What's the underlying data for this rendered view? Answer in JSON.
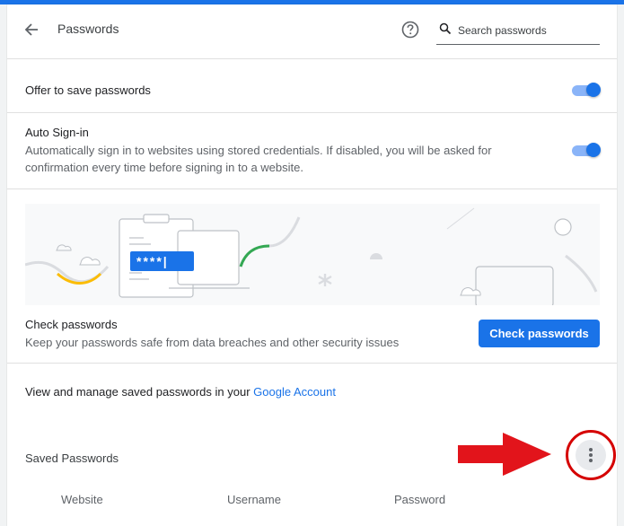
{
  "header": {
    "title": "Passwords",
    "search_placeholder": "Search passwords",
    "search_value": ""
  },
  "settings": {
    "offer_save": {
      "label": "Offer to save passwords",
      "enabled": true
    },
    "auto_signin": {
      "label": "Auto Sign-in",
      "description": "Automatically sign in to websites using stored credentials. If disabled, you will be asked for confirmation every time before signing in to a website.",
      "enabled": true
    }
  },
  "illustration": {
    "masked_password": "****|"
  },
  "check": {
    "title": "Check passwords",
    "description": "Keep your passwords safe from data breaches and other security issues",
    "button_label": "Check passwords"
  },
  "account": {
    "text_prefix": "View and manage saved passwords in your ",
    "link_label": "Google Account"
  },
  "saved": {
    "title": "Saved Passwords",
    "columns": [
      "Website",
      "Username",
      "Password"
    ]
  },
  "colors": {
    "accent": "#1a73e8",
    "toggle_track": "#8ab4f8",
    "annotation": "#d50000"
  },
  "icons": {
    "back": "arrow-back-icon",
    "help": "help-icon",
    "search": "search-icon",
    "menu": "more-vert-icon"
  }
}
